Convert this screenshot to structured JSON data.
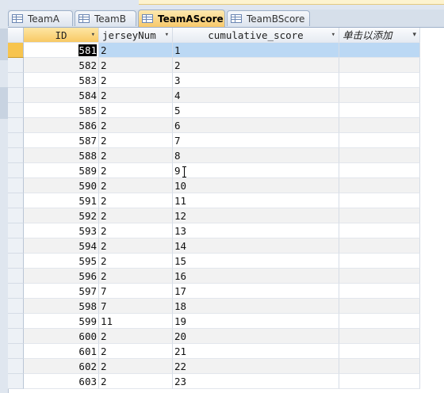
{
  "tabs": [
    {
      "label": "TeamA",
      "active": false
    },
    {
      "label": "TeamB",
      "active": false
    },
    {
      "label": "TeamAScore",
      "active": true
    },
    {
      "label": "TeamBScore",
      "active": false
    }
  ],
  "columns": [
    {
      "label": "ID",
      "arrow": "▾"
    },
    {
      "label": "jerseyNum",
      "arrow": "▾"
    },
    {
      "label": "cumulative_score",
      "arrow": "▾"
    },
    {
      "label": "单击以添加",
      "arrow": "▾"
    }
  ],
  "rows": [
    {
      "id": "581",
      "jersey": "2",
      "score": "1"
    },
    {
      "id": "582",
      "jersey": "2",
      "score": "2"
    },
    {
      "id": "583",
      "jersey": "2",
      "score": "3"
    },
    {
      "id": "584",
      "jersey": "2",
      "score": "4"
    },
    {
      "id": "585",
      "jersey": "2",
      "score": "5"
    },
    {
      "id": "586",
      "jersey": "2",
      "score": "6"
    },
    {
      "id": "587",
      "jersey": "2",
      "score": "7"
    },
    {
      "id": "588",
      "jersey": "2",
      "score": "8"
    },
    {
      "id": "589",
      "jersey": "2",
      "score": "9"
    },
    {
      "id": "590",
      "jersey": "2",
      "score": "10"
    },
    {
      "id": "591",
      "jersey": "2",
      "score": "11"
    },
    {
      "id": "592",
      "jersey": "2",
      "score": "12"
    },
    {
      "id": "593",
      "jersey": "2",
      "score": "13"
    },
    {
      "id": "594",
      "jersey": "2",
      "score": "14"
    },
    {
      "id": "595",
      "jersey": "2",
      "score": "15"
    },
    {
      "id": "596",
      "jersey": "2",
      "score": "16"
    },
    {
      "id": "597",
      "jersey": "7",
      "score": "17"
    },
    {
      "id": "598",
      "jersey": "7",
      "score": "18"
    },
    {
      "id": "599",
      "jersey": "11",
      "score": "19"
    },
    {
      "id": "600",
      "jersey": "2",
      "score": "20"
    },
    {
      "id": "601",
      "jersey": "2",
      "score": "21"
    },
    {
      "id": "602",
      "jersey": "2",
      "score": "22"
    },
    {
      "id": "603",
      "jersey": "2",
      "score": "23"
    }
  ],
  "selected_row": 0,
  "colors": {
    "active_tab": "#f7c86a",
    "selected_row": "#bbd8f4",
    "record_selector_current": "#f7c44e"
  },
  "icons": [
    "table-icon",
    "dropdown-arrow-icon",
    "text-cursor-icon"
  ]
}
